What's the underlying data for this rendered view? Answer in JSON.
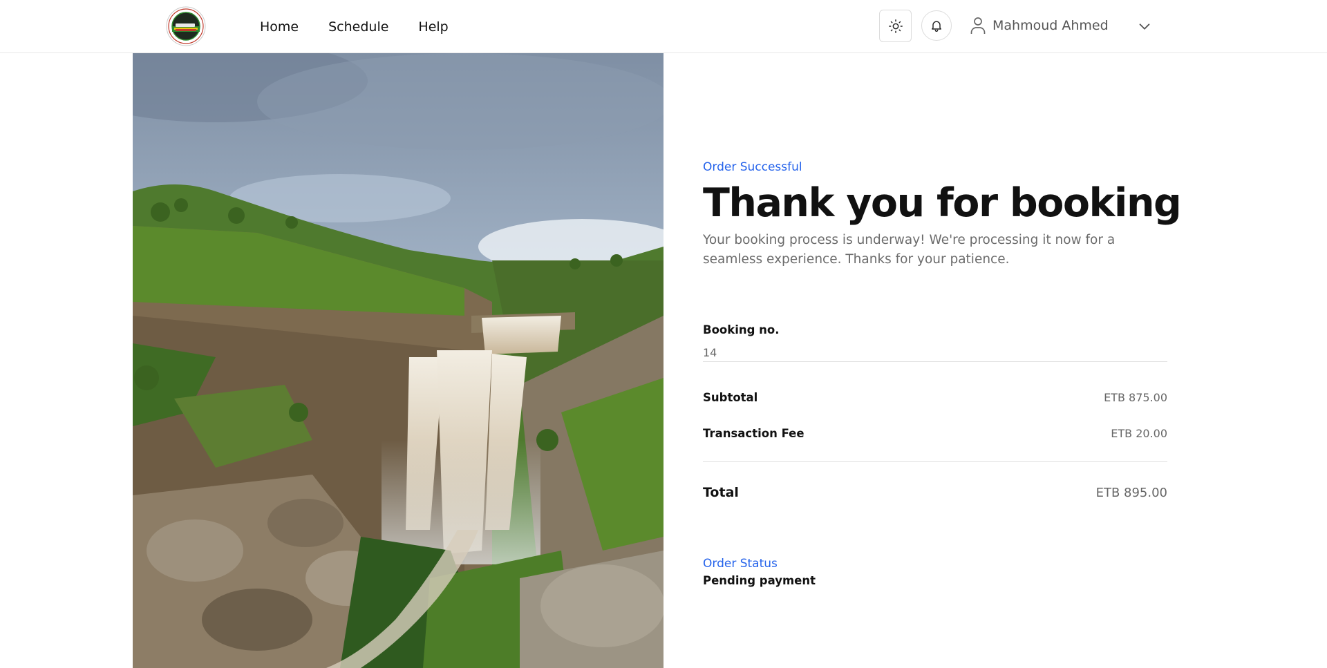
{
  "nav": {
    "links": [
      "Home",
      "Schedule",
      "Help"
    ],
    "user_name": "Mahmoud Ahmed"
  },
  "order": {
    "eyebrow": "Order Successful",
    "title": "Thank you for booking",
    "description": "Your booking process is underway! We're processing it now for a seamless experience. Thanks for your patience.",
    "booking_label": "Booking no.",
    "booking_number": "14",
    "subtotal_label": "Subtotal",
    "subtotal_value": "ETB 875.00",
    "fee_label": "Transaction Fee",
    "fee_value": "ETB 20.00",
    "total_label": "Total",
    "total_value": "ETB 895.00",
    "status_label": "Order Status",
    "status_value": "Pending payment"
  },
  "icons": {
    "theme": "sun-icon",
    "notifications": "bell-icon",
    "user": "user-icon",
    "menu": "chevron-down-icon"
  },
  "colors": {
    "accent": "#2563eb",
    "text": "#111111",
    "muted": "#6b6b6b",
    "border": "#e0e0e0"
  }
}
